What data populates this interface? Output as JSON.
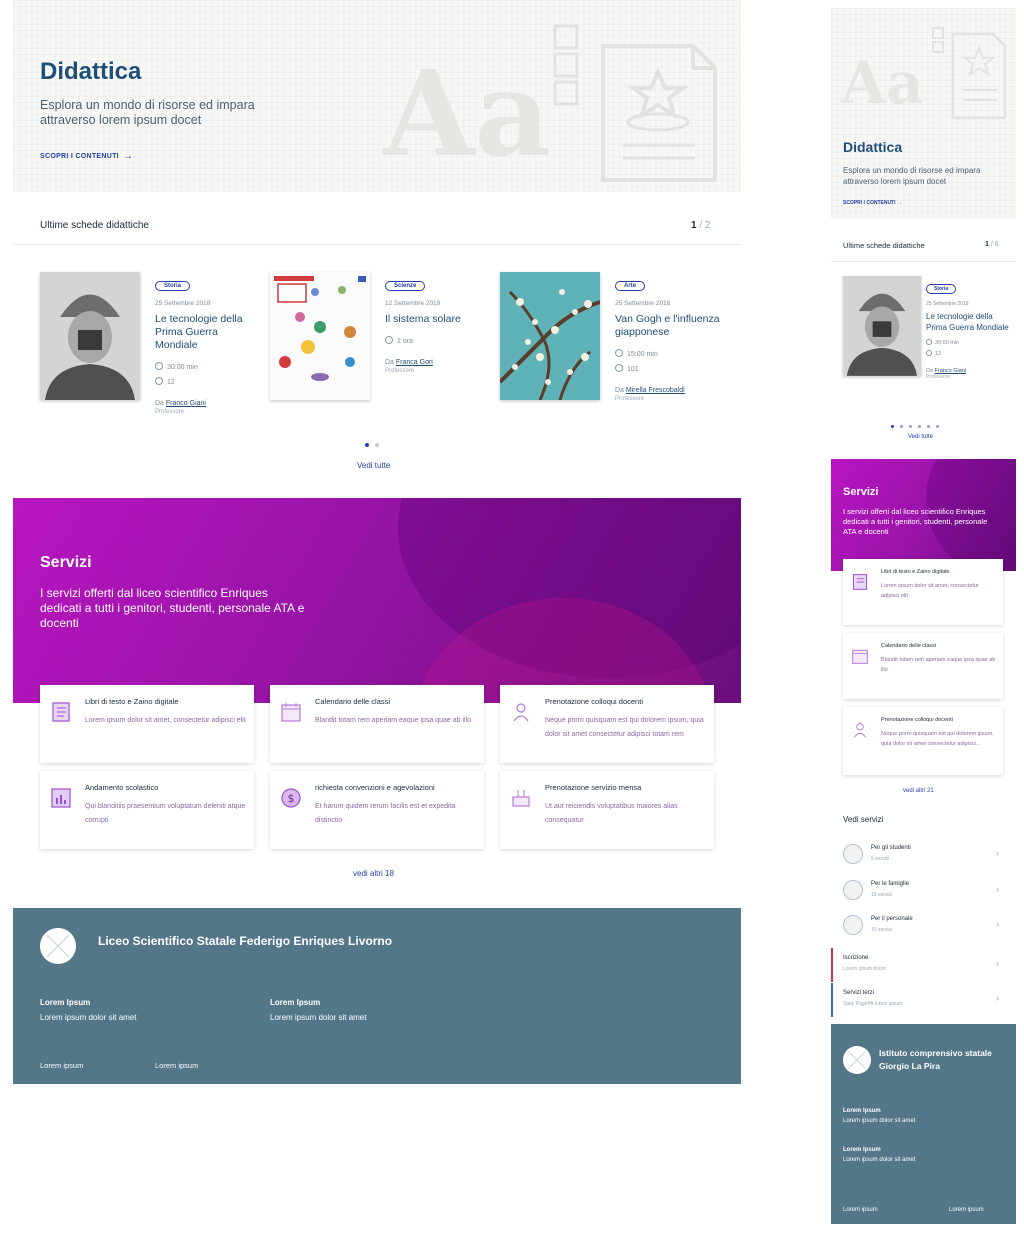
{
  "desktop": {
    "hero": {
      "title": "Didattica",
      "subtitle": "Esplora un mondo di risorse ed impara attraverso lorem ipsum docet",
      "link": "SCOPRI I CONTENUTI",
      "decor_text": "Aa"
    },
    "latest": {
      "heading": "Ultime schede didattiche",
      "page_current": "1",
      "page_total": " / 2",
      "cards": [
        {
          "tag": "Storia",
          "date": "25 Settembre 2018",
          "title": "Le tecnologie della Prima Guerra Mondiale",
          "duration": "30:00 min",
          "comments": "12",
          "author_prefix": "Da ",
          "author": "Franco Giani",
          "role": "Professore"
        },
        {
          "tag": "Scienze",
          "date": "12 Settembre 2018",
          "title": "Il sistema solare",
          "duration": "1 ora",
          "author_prefix": "Da ",
          "author": "Franca Gori",
          "role": "Professore"
        },
        {
          "tag": "Arte",
          "date": "25 Settembre 2018",
          "title": "Van Gogh e l'influenza giapponese",
          "duration": "15:00 min",
          "comments": "101",
          "author_prefix": "Da ",
          "author": "Mirella Frescobaldi",
          "role": "Professore"
        }
      ],
      "see_all": "Vedi tutte"
    },
    "services": {
      "title": "Servizi",
      "subtitle": "I servizi offerti dal liceo scientifico Enriques dedicati a tutti i genitori, studenti, personale ATA e docenti",
      "items": [
        {
          "title": "Libri di testo e Zaino digitale",
          "desc": "Lorem ipsum dolor sit amet, consectetur adipisci elit"
        },
        {
          "title": "Calendario delle classi",
          "desc": "Blandit totam rem aperiam eaque ipsa quae ab illo"
        },
        {
          "title": "Prenotazione colloqui docenti",
          "desc": "Neque porro quisquam est qui dolorem ipsum, quia dolor sit amet consectetur adipisci totam rem"
        },
        {
          "title": "Andamento scolastico",
          "desc": "Qui blanditiis praesentium voluptatum deleniti atque corrupti"
        },
        {
          "title": "richiesta convenzioni e agevolazioni",
          "desc": "Et harum quidem rerum facilis est et expedita distinctio"
        },
        {
          "title": "Prenotazione servizio mensa",
          "desc": "Ut aut reiciendis voluptatibus maiores alias consequatur"
        }
      ],
      "more": "vedi altri 18"
    },
    "footer": {
      "name": "Liceo Scientifico Statale Federigo Enriques Livorno",
      "col1_title": "Lorem Ipsum",
      "col1_text": "Lorem ipsum dolor sit amet",
      "col2_title": "Lorem Ipsum",
      "col2_text": "Lorem ipsum dolor sit amet",
      "bottom1": "Lorem ipsum",
      "bottom2": "Lorem ipsum"
    }
  },
  "mobile": {
    "hero": {
      "title": "Didattica",
      "subtitle": "Esplora un mondo di risorse ed impara attraverso lorem ipsum docet",
      "link": "SCOPRI I CONTENUTI",
      "decor_text": "Aa"
    },
    "latest": {
      "heading": "Ultime schede didattiche",
      "page_current": "1",
      "page_total": " / 6",
      "card": {
        "tag": "Storia",
        "date": "25 Settembre 2018",
        "title": "Le tecnologie della Prima Guerra Mondiale",
        "duration": "30:00 min",
        "comments": "12",
        "author_prefix": "Da ",
        "author": "Franco Giani",
        "role": "Professore"
      },
      "see_all": "Vedi tutte"
    },
    "services": {
      "title": "Servizi",
      "subtitle": "I servizi offerti dal liceo scientifico Enriques dedicati a tutti i genitori, studenti, personale ATA e docenti",
      "items": [
        {
          "title": "Libri di testo e Zaino digitale",
          "desc": "Lorem ipsum dolor sit amet, consectetur adipisci elit"
        },
        {
          "title": "Calendario delle classi",
          "desc": "Blandit totam rem aperiam eaque ipsa quae ab illo"
        },
        {
          "title": "Prenotazione colloqui docenti",
          "desc": "Neque porro quisquam est qui dolorem ipsum, quia dolor sit amet consectetur adipisci…"
        }
      ],
      "more": "vedi altri 21"
    },
    "see_services": {
      "heading": "Vedi servizi",
      "rows": [
        {
          "title": "Per gli studenti",
          "sub": "5 servizi"
        },
        {
          "title": "Per le famiglie",
          "sub": "15 servizi"
        },
        {
          "title": "Per il personale",
          "sub": "10 servizi"
        }
      ],
      "plain_rows": [
        {
          "title": "Iscrizione",
          "sub": "Lorem ipsum docet",
          "accent": "#d1344a"
        },
        {
          "title": "Servizi terzi",
          "sub": "Spid, PagoPA lorem ipsum",
          "accent": "#2c6fc8"
        }
      ]
    },
    "footer": {
      "name": "Istituto comprensivo statale Giorgio La Pira",
      "col1_title": "Lorem Ipsum",
      "col1_text": "Lorem ipsum dolor sit amet",
      "col2_title": "Lorem Ipsum",
      "col2_text": "Lorem ipsum dolor sit amet",
      "bottom1": "Lorem ipsum",
      "bottom2": "Lorem ipsum"
    }
  },
  "colors": {
    "primary": "#1f4e79",
    "link": "#2440a8",
    "services_gradient_start": "#b815c0",
    "services_gradient_end": "#6a0f7c",
    "footer": "#537688",
    "icon_accent": "#9b4fd0"
  }
}
